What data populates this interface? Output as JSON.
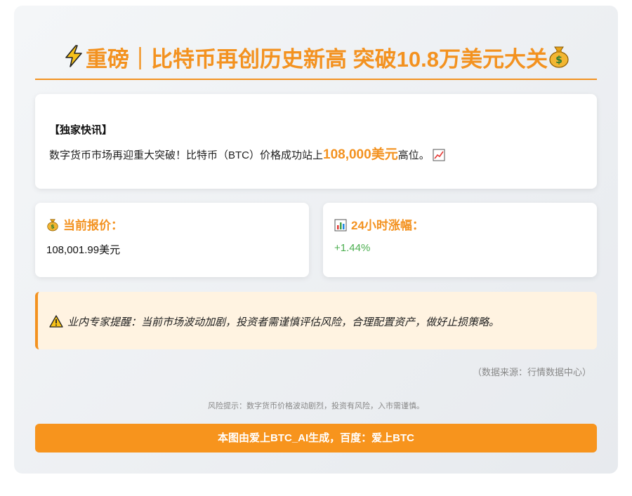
{
  "header": {
    "title": "重磅｜比特币再创历史新高 突破10.8万美元大关",
    "lead_icon": "lightning-icon",
    "trail_icon": "money-bag-icon"
  },
  "news": {
    "heading": "【独家快讯】",
    "body_before": "数字货币市场再迎重大突破！比特币（BTC）价格成功站上",
    "body_highlight": "108,000美元",
    "body_after": "高位。",
    "trail_icon": "chart-increasing-icon"
  },
  "price": {
    "icon": "money-bag-icon",
    "label": "当前报价：",
    "value": "108,001.99美元"
  },
  "change": {
    "icon": "bar-chart-icon",
    "label": "24小时涨幅：",
    "value": "+1.44%"
  },
  "alert": {
    "icon": "warning-icon",
    "text": "业内专家提醒：当前市场波动加剧，投资者需谨慎评估风险，合理配置资产，做好止损策略。"
  },
  "source": "（数据来源：行情数据中心）",
  "risk_note": "风险提示：数字货币价格波动剧烈，投资有风险，入市需谨慎。",
  "footer": "本图由爱上BTC_AI生成，百度：爱上BTC",
  "colors": {
    "accent": "#f39220",
    "positive": "#4caf50",
    "alert_bg": "#fff3e1"
  }
}
